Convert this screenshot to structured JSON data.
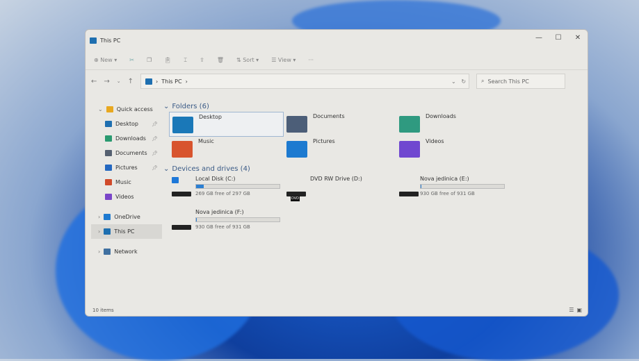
{
  "window": {
    "title": "This PC",
    "minimize": "—",
    "maximize": "☐",
    "close": "✕"
  },
  "toolbar": {
    "new": "New",
    "sort": "Sort",
    "view": "View",
    "more": "···"
  },
  "address": {
    "path": "This PC",
    "search_placeholder": "Search This PC"
  },
  "sidebar": {
    "items": [
      {
        "label": "Quick access",
        "color": "#e8a820"
      },
      {
        "label": "Desktop",
        "color": "#1e6fb0",
        "pinned": true
      },
      {
        "label": "Downloads",
        "color": "#2a9a70",
        "pinned": true
      },
      {
        "label": "Documents",
        "color": "#556070",
        "pinned": true
      },
      {
        "label": "Pictures",
        "color": "#2468c0",
        "pinned": true
      },
      {
        "label": "Music",
        "color": "#d04a2a"
      },
      {
        "label": "Videos",
        "color": "#7a45c8"
      },
      {
        "label": "OneDrive",
        "color": "#1e7ad0"
      },
      {
        "label": "This PC",
        "color": "#1e6fb0"
      },
      {
        "label": "Network",
        "color": "#4070a0"
      }
    ]
  },
  "folders": {
    "header": "Folders (6)",
    "items": [
      {
        "name": "Desktop",
        "color": "#1a78b8"
      },
      {
        "name": "Documents",
        "color": "#4c5e78"
      },
      {
        "name": "Downloads",
        "color": "#2f9a80"
      },
      {
        "name": "Music",
        "color": "#d8542e"
      },
      {
        "name": "Pictures",
        "color": "#1d7ad0"
      },
      {
        "name": "Videos",
        "color": "#7048d0"
      }
    ]
  },
  "drives": {
    "header": "Devices and drives (4)",
    "items": [
      {
        "name": "Local Disk (C:)",
        "free": "269 GB free of 297 GB",
        "used_fraction": 0.094
      },
      {
        "name": "DVD RW Drive (D:)",
        "label": "DVD"
      },
      {
        "name": "Nova jedinica (E:)",
        "free": "930 GB free of 931 GB",
        "used_fraction": 0.001
      },
      {
        "name": "Nova jedinica (F:)",
        "free": "930 GB free of 931 GB",
        "used_fraction": 0.001
      }
    ]
  },
  "status": {
    "count": "10 items"
  }
}
